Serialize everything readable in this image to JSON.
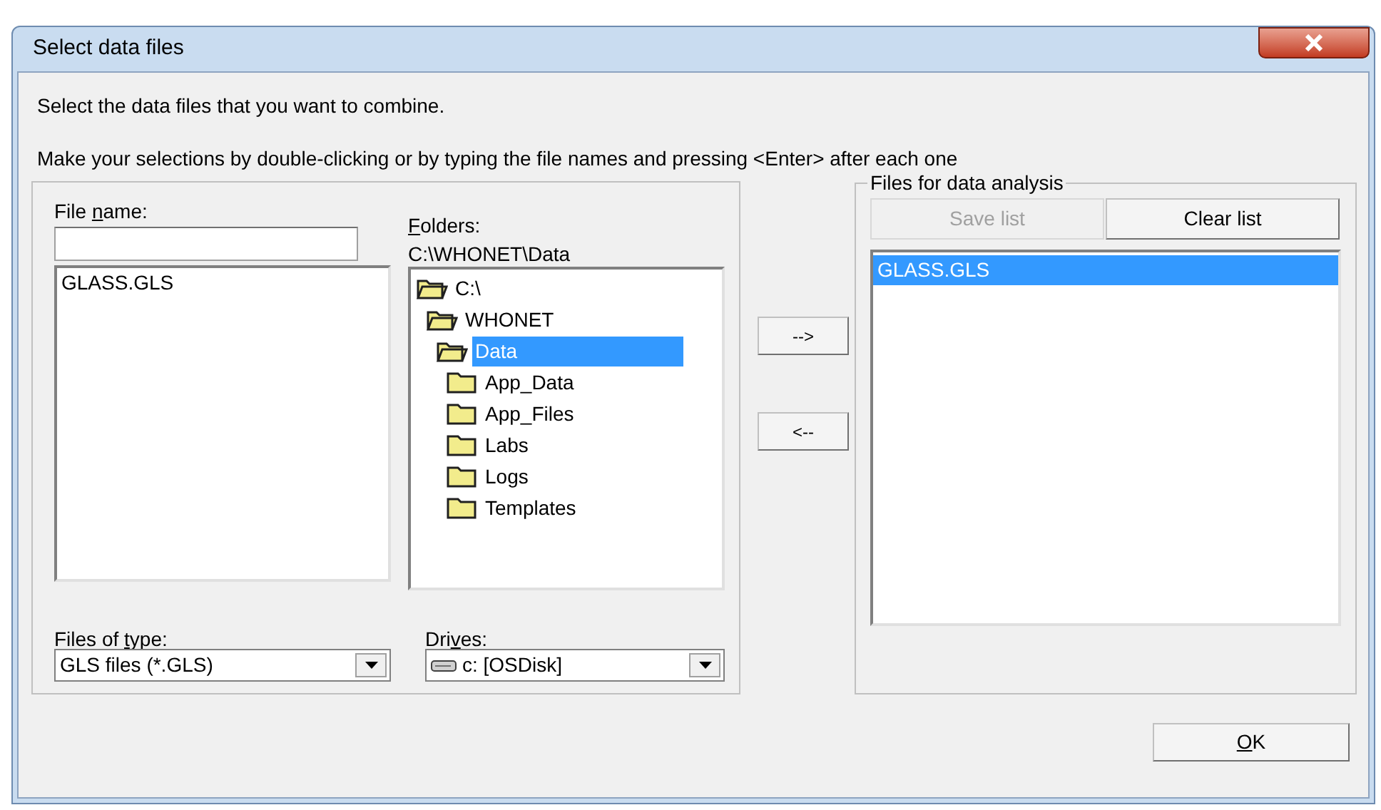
{
  "window": {
    "title": "Select data files"
  },
  "instructions": [
    "Select the data files that you want to combine.",
    "Make your selections by double-clicking or by typing the file names and pressing <Enter> after each one"
  ],
  "file_name": {
    "label_parts": {
      "before": "File ",
      "accel": "n",
      "after": "ame:"
    }
  },
  "files": [
    {
      "name": "GLASS.GLS",
      "selected": false
    }
  ],
  "folders": {
    "label_parts": {
      "accel": "F",
      "after": "olders:"
    },
    "path": "C:\\WHONET\\Data",
    "tree": [
      {
        "name": "C:\\",
        "expanded": true,
        "selected": false,
        "children": [
          {
            "name": "WHONET",
            "expanded": true,
            "selected": false,
            "children": [
              {
                "name": "Data",
                "expanded": true,
                "selected": true,
                "children": [
                  {
                    "name": "App_Data",
                    "expanded": false,
                    "selected": false
                  },
                  {
                    "name": "App_Files",
                    "expanded": false,
                    "selected": false
                  },
                  {
                    "name": "Labs",
                    "expanded": false,
                    "selected": false
                  },
                  {
                    "name": "Logs",
                    "expanded": false,
                    "selected": false
                  },
                  {
                    "name": "Templates",
                    "expanded": false,
                    "selected": false
                  }
                ]
              }
            ]
          }
        ]
      }
    ]
  },
  "add_button": "-->",
  "remove_button": "<--",
  "files_of_type": {
    "label_parts": {
      "before": "Files of ",
      "accel": "t",
      "after": "ype:"
    },
    "value": "GLS files (*.GLS)"
  },
  "drives": {
    "label_parts": {
      "before": "Dri",
      "accel": "v",
      "after": "es:"
    },
    "value": "c: [OSDisk]"
  },
  "analysis": {
    "title": "Files for data analysis",
    "buttons": [
      {
        "label": "Save list",
        "disabled": true
      },
      {
        "label": "Clear list",
        "disabled": false
      }
    ],
    "files": [
      {
        "name": "GLASS.GLS",
        "selected": true
      }
    ]
  },
  "ok_button": {
    "accel": "O",
    "after": "K"
  }
}
